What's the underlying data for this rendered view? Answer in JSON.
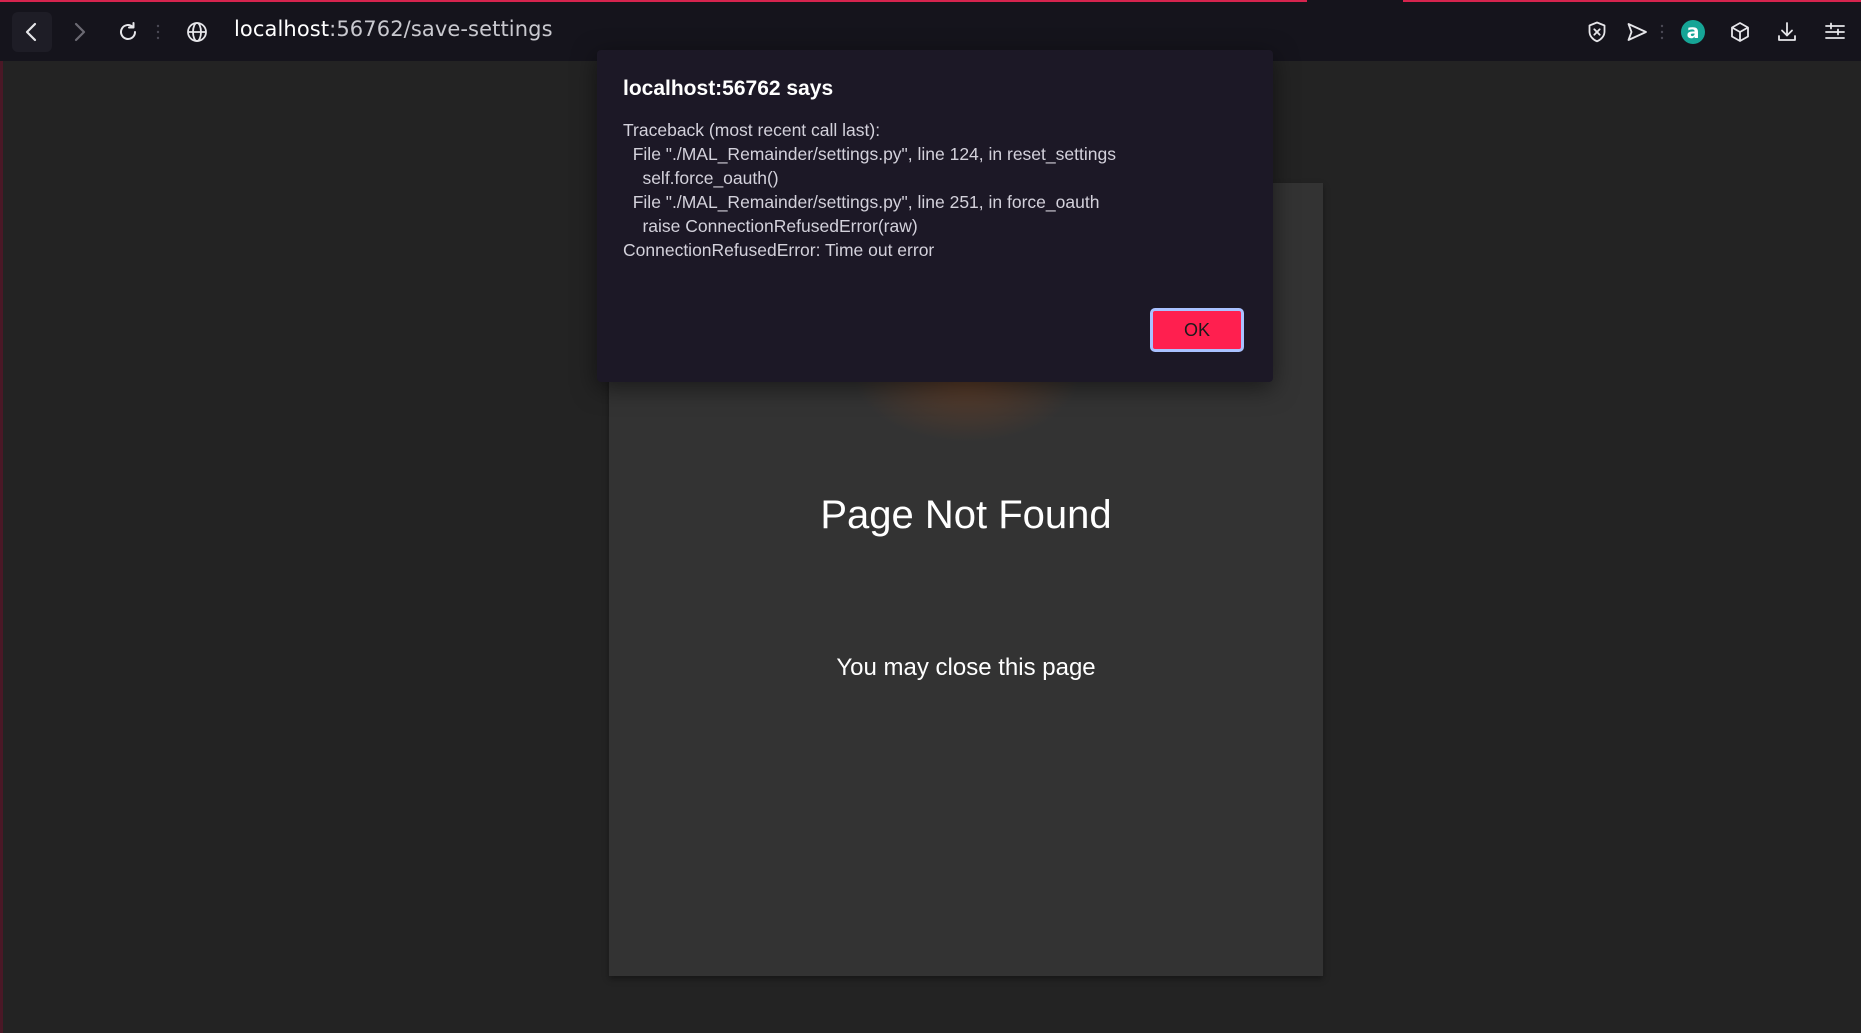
{
  "browser": {
    "url_host": "localhost",
    "url_rest": ":56762/save-settings",
    "accent_color": "#d6244e",
    "icons": {
      "back": "back-arrow-icon",
      "forward": "forward-arrow-icon",
      "reload": "reload-icon",
      "site_info": "globe-icon",
      "shield": "shield-icon",
      "send": "send-icon",
      "extension": "extension-a-icon",
      "box": "box-icon",
      "download": "download-icon",
      "menu": "menu-icon"
    },
    "extension_letter": "a"
  },
  "dialog": {
    "title": "localhost:56762 says",
    "message": "Traceback (most recent call last):\n  File \"./MAL_Remainder/settings.py\", line 124, in reset_settings\n    self.force_oauth()\n  File \"./MAL_Remainder/settings.py\", line 251, in force_oauth\n    raise ConnectionRefusedError(raw)\nConnectionRefusedError: Time out error",
    "ok_label": "OK",
    "ok_color": "#ff1f4f"
  },
  "page": {
    "title": "Page Not Found",
    "subtitle": "You may close this page",
    "card_color": "#333333",
    "background_color": "#232323"
  }
}
